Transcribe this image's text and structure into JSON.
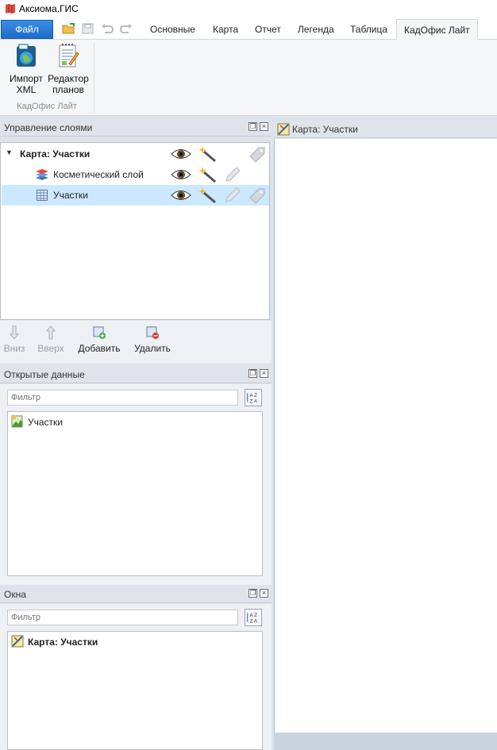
{
  "window": {
    "title": "Аксиома.ГИС"
  },
  "ribbon": {
    "file_label": "Файл",
    "tabs": [
      "Основные",
      "Карта",
      "Отчет",
      "Легенда",
      "Таблица",
      "КадОфис Лайт"
    ],
    "active_tab": "КадОфис Лайт",
    "buttons": [
      {
        "label": "Импорт XML",
        "line1": "Импорт",
        "line2": "XML"
      },
      {
        "label": "Редактор планов",
        "line1": "Редактор",
        "line2": "планов"
      }
    ],
    "group_label": "КадОфис Лайт"
  },
  "layers_panel": {
    "title": "Управление слоями",
    "map_node": "Карта: Участки",
    "layers": [
      {
        "name": "Косметический слой",
        "selected": false
      },
      {
        "name": "Участки",
        "selected": true
      }
    ],
    "toolbar": {
      "down": "Вниз",
      "up": "Вверх",
      "add": "Добавить",
      "remove": "Удалить"
    }
  },
  "open_data_panel": {
    "title": "Открытые данные",
    "filter_placeholder": "Фильтр",
    "items": [
      "Участки"
    ]
  },
  "windows_panel": {
    "title": "Окна",
    "filter_placeholder": "Фильтр",
    "items": [
      "Карта: Участки"
    ]
  },
  "map_window": {
    "title": "Карта: Участки"
  },
  "colors": {
    "file_button": "#1e6cc8",
    "selection": "#cce8ff",
    "panel_header": "#dfe4ea"
  }
}
